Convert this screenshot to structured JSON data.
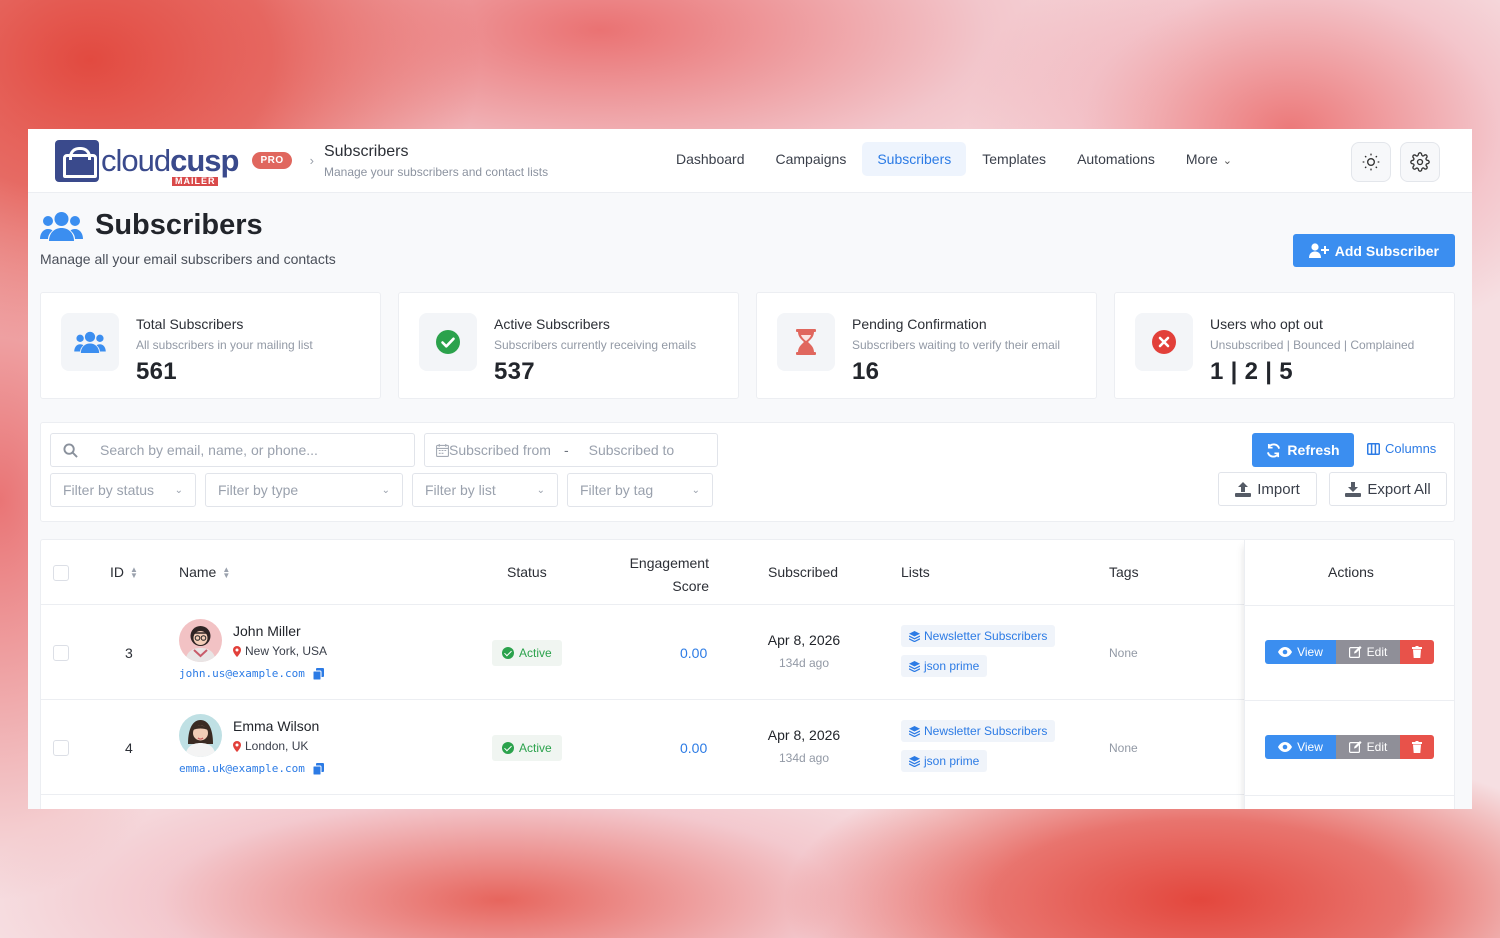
{
  "brand": {
    "name_light": "cloud",
    "name_bold": "cusp",
    "sub": "MAILER",
    "pro": "PRO"
  },
  "breadcrumb": {
    "title": "Subscribers",
    "subtitle": "Manage your subscribers and contact lists"
  },
  "nav": {
    "items": [
      "Dashboard",
      "Campaigns",
      "Subscribers",
      "Templates",
      "Automations",
      "More"
    ],
    "active": "Subscribers"
  },
  "header_icons": [
    "sun-icon",
    "gear-icon"
  ],
  "page": {
    "title": "Subscribers",
    "subtitle": "Manage all your email subscribers and contacts",
    "add_button": "Add Subscriber"
  },
  "stats": [
    {
      "label": "Total Subscribers",
      "desc": "All subscribers in your mailing list",
      "value": "561",
      "icon": "users-icon",
      "color": "#3b8ef0"
    },
    {
      "label": "Active Subscribers",
      "desc": "Subscribers currently receiving emails",
      "value": "537",
      "icon": "check-circle-icon",
      "color": "#2ba24c"
    },
    {
      "label": "Pending Confirmation",
      "desc": "Subscribers waiting to verify their email",
      "value": "16",
      "icon": "hourglass-icon",
      "color": "#e0675e"
    },
    {
      "label": "Users who opt out",
      "desc": "Unsubscribed | Bounced | Complained",
      "value": "1 | 2 | 5",
      "icon": "x-circle-icon",
      "color": "#e2403a"
    }
  ],
  "filters": {
    "search_placeholder": "Search by email, name, or phone...",
    "date_from": "Subscribed from",
    "date_sep": "-",
    "date_to": "Subscribed to",
    "status": "Filter by status",
    "type": "Filter by type",
    "list": "Filter by list",
    "tag": "Filter by tag",
    "refresh": "Refresh",
    "columns": "Columns",
    "import": "Import",
    "export": "Export All"
  },
  "table": {
    "headers": {
      "id": "ID",
      "name": "Name",
      "status": "Status",
      "engagement_1": "Engagement",
      "engagement_2": "Score",
      "subscribed": "Subscribed",
      "lists": "Lists",
      "tags": "Tags",
      "actions": "Actions"
    },
    "rows": [
      {
        "id": "3",
        "name": "John Miller",
        "location": "New York, USA",
        "email": "john.us@example.com",
        "status": "Active",
        "score": "0.00",
        "date": "Apr 8, 2026",
        "ago": "134d ago",
        "lists": [
          "Newsletter Subscribers",
          "json prime"
        ],
        "tags": "None"
      },
      {
        "id": "4",
        "name": "Emma Wilson",
        "location": "London, UK",
        "email": "emma.uk@example.com",
        "status": "Active",
        "score": "0.00",
        "date": "Apr 8, 2026",
        "ago": "134d ago",
        "lists": [
          "Newsletter Subscribers",
          "json prime"
        ],
        "tags": "None"
      }
    ],
    "actions": {
      "view": "View",
      "edit": "Edit"
    }
  }
}
